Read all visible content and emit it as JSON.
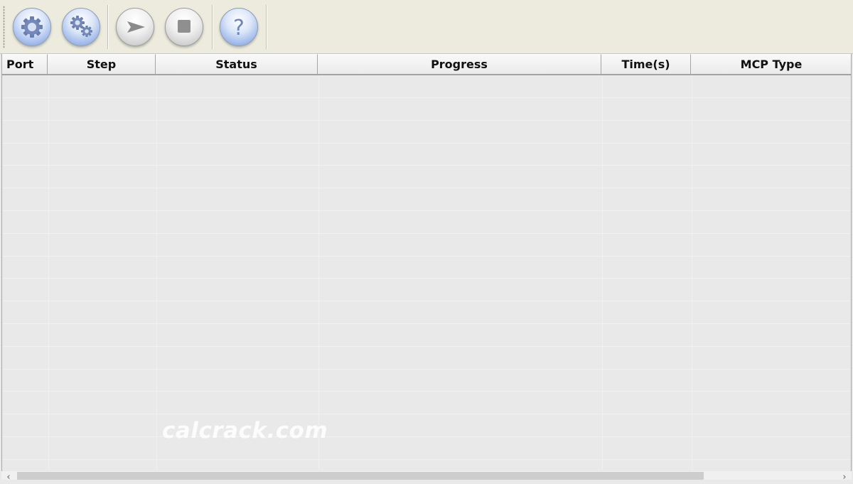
{
  "toolbar": {
    "buttons": [
      {
        "name": "gear-icon",
        "style": "blue"
      },
      {
        "name": "gears-icon",
        "style": "blue"
      },
      {
        "name": "play-arrow-icon",
        "style": "grey"
      },
      {
        "name": "stop-icon",
        "style": "grey"
      },
      {
        "name": "help-question-icon",
        "style": "blue"
      }
    ]
  },
  "table": {
    "columns": [
      "Port",
      "Step",
      "Status",
      "Progress",
      "Time(s)",
      "MCP Type"
    ],
    "rows": []
  },
  "watermark": "calcrack.com",
  "scrollbar": {
    "left_arrow": "‹",
    "right_arrow": "›"
  },
  "colors": {
    "toolbar_bg": "#ecebdd",
    "grid_bg": "#e9e9e9",
    "button_blue": "#9fb9ea",
    "button_grey": "#cfcfcf"
  }
}
